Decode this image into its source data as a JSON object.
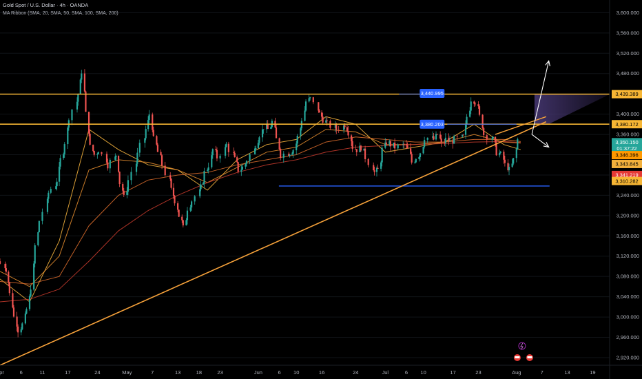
{
  "header": {
    "title": "Gold Spot / U.S. Dollar · 4h · OANDA",
    "indicator": "MA Ribbon (SMA, 20, SMA, 50, SMA, 100, SMA, 200)"
  },
  "colors": {
    "background": "#000000",
    "bull": "#26a69a",
    "bear": "#ef5350",
    "resistance": "#f7b634",
    "trendline": "#f7a23a",
    "support": "#2962ff",
    "ma20": "#f2b03c",
    "ma50": "#e08a2e",
    "ma100": "#d5692b",
    "ma200": "#c0392b",
    "arrow": "#ffffff",
    "zone": "#4a3a78"
  },
  "chart_data": {
    "type": "candlestick",
    "x_tick_labels": [
      "Apr",
      "6",
      "11",
      "17",
      "24",
      "May",
      "7",
      "13",
      "18",
      "23",
      "Jun",
      "6",
      "10",
      "16",
      "24",
      "Jul",
      "6",
      "10",
      "17",
      "23",
      "Aug",
      "7",
      "13",
      "19"
    ],
    "y_tick_labels": [
      "2,920.000",
      "2,960.000",
      "3,000.000",
      "3,040.000",
      "3,080.000",
      "3,120.000",
      "3,160.000",
      "3,200.000",
      "3,240.000",
      "3,280.000",
      "3,320.000",
      "3,360.000",
      "3,400.000",
      "3,440.000",
      "3,480.000",
      "3,520.000",
      "3,560.000",
      "3,600.000"
    ],
    "y_ticks": [
      2920,
      2960,
      3000,
      3040,
      3080,
      3120,
      3160,
      3200,
      3240,
      3280,
      3320,
      3360,
      3400,
      3440,
      3480,
      3520,
      3560,
      3600
    ],
    "ylim": [
      2905,
      3625
    ],
    "x_start": "2025-04-01",
    "x_end": "2025-08-23",
    "closes": [
      [
        "2025-04-01",
        3110
      ],
      [
        "2025-04-03",
        3095
      ],
      [
        "2025-04-04",
        3045
      ],
      [
        "2025-04-05",
        3000
      ],
      [
        "2025-04-06",
        2975
      ],
      [
        "2025-04-07",
        2985
      ],
      [
        "2025-04-08",
        3015
      ],
      [
        "2025-04-09",
        3060
      ],
      [
        "2025-04-10",
        3140
      ],
      [
        "2025-04-11",
        3190
      ],
      [
        "2025-04-13",
        3245
      ],
      [
        "2025-04-15",
        3270
      ],
      [
        "2025-04-16",
        3310
      ],
      [
        "2025-04-17",
        3345
      ],
      [
        "2025-04-18",
        3395
      ],
      [
        "2025-04-20",
        3440
      ],
      [
        "2025-04-21",
        3485
      ],
      [
        "2025-04-22",
        3400
      ],
      [
        "2025-04-23",
        3335
      ],
      [
        "2025-04-24",
        3320
      ],
      [
        "2025-04-25",
        3330
      ],
      [
        "2025-04-27",
        3300
      ],
      [
        "2025-04-29",
        3320
      ],
      [
        "2025-04-30",
        3265
      ],
      [
        "2025-05-01",
        3235
      ],
      [
        "2025-05-02",
        3270
      ],
      [
        "2025-05-04",
        3320
      ],
      [
        "2025-05-06",
        3370
      ],
      [
        "2025-05-07",
        3400
      ],
      [
        "2025-05-08",
        3350
      ],
      [
        "2025-05-09",
        3325
      ],
      [
        "2025-05-10",
        3300
      ],
      [
        "2025-05-12",
        3250
      ],
      [
        "2025-05-13",
        3230
      ],
      [
        "2025-05-14",
        3200
      ],
      [
        "2025-05-15",
        3175
      ],
      [
        "2025-05-16",
        3215
      ],
      [
        "2025-05-17",
        3230
      ],
      [
        "2025-05-19",
        3255
      ],
      [
        "2025-05-20",
        3285
      ],
      [
        "2025-05-21",
        3300
      ],
      [
        "2025-05-22",
        3330
      ],
      [
        "2025-05-23",
        3315
      ],
      [
        "2025-05-25",
        3340
      ],
      [
        "2025-05-27",
        3310
      ],
      [
        "2025-05-28",
        3290
      ],
      [
        "2025-05-29",
        3295
      ],
      [
        "2025-05-30",
        3310
      ],
      [
        "2025-06-01",
        3340
      ],
      [
        "2025-06-02",
        3360
      ],
      [
        "2025-06-03",
        3375
      ],
      [
        "2025-06-04",
        3370
      ],
      [
        "2025-06-05",
        3385
      ],
      [
        "2025-06-06",
        3350
      ],
      [
        "2025-06-07",
        3320
      ],
      [
        "2025-06-09",
        3325
      ],
      [
        "2025-06-10",
        3330
      ],
      [
        "2025-06-11",
        3355
      ],
      [
        "2025-06-12",
        3390
      ],
      [
        "2025-06-13",
        3425
      ],
      [
        "2025-06-14",
        3430
      ],
      [
        "2025-06-16",
        3400
      ],
      [
        "2025-06-17",
        3390
      ],
      [
        "2025-06-18",
        3380
      ],
      [
        "2025-06-20",
        3370
      ],
      [
        "2025-06-22",
        3380
      ],
      [
        "2025-06-23",
        3365
      ],
      [
        "2025-06-24",
        3335
      ],
      [
        "2025-06-25",
        3330
      ],
      [
        "2025-06-26",
        3335
      ],
      [
        "2025-06-27",
        3315
      ],
      [
        "2025-06-29",
        3285
      ],
      [
        "2025-06-30",
        3290
      ],
      [
        "2025-07-01",
        3330
      ],
      [
        "2025-07-02",
        3345
      ],
      [
        "2025-07-03",
        3340
      ],
      [
        "2025-07-04",
        3335
      ],
      [
        "2025-07-06",
        3340
      ],
      [
        "2025-07-07",
        3330
      ],
      [
        "2025-07-08",
        3305
      ],
      [
        "2025-07-09",
        3315
      ],
      [
        "2025-07-10",
        3325
      ],
      [
        "2025-07-11",
        3355
      ],
      [
        "2025-07-13",
        3350
      ],
      [
        "2025-07-14",
        3360
      ],
      [
        "2025-07-15",
        3340
      ],
      [
        "2025-07-16",
        3350
      ],
      [
        "2025-07-17",
        3345
      ],
      [
        "2025-07-18",
        3350
      ],
      [
        "2025-07-20",
        3355
      ],
      [
        "2025-07-21",
        3395
      ],
      [
        "2025-07-22",
        3430
      ],
      [
        "2025-07-23",
        3425
      ],
      [
        "2025-07-24",
        3395
      ],
      [
        "2025-07-25",
        3360
      ],
      [
        "2025-07-27",
        3350
      ],
      [
        "2025-07-28",
        3325
      ],
      [
        "2025-07-29",
        3320
      ],
      [
        "2025-07-30",
        3300
      ],
      [
        "2025-07-31",
        3290
      ],
      [
        "2025-08-01",
        3310
      ],
      [
        "2025-08-02",
        3350
      ]
    ],
    "moving_averages": [
      {
        "name": "SMA 20",
        "points": [
          [
            "2025-04-01",
            3075
          ],
          [
            "2025-04-08",
            3030
          ],
          [
            "2025-04-15",
            3150
          ],
          [
            "2025-04-22",
            3370
          ],
          [
            "2025-04-29",
            3330
          ],
          [
            "2025-05-06",
            3300
          ],
          [
            "2025-05-13",
            3290
          ],
          [
            "2025-05-20",
            3250
          ],
          [
            "2025-05-27",
            3310
          ],
          [
            "2025-06-03",
            3340
          ],
          [
            "2025-06-10",
            3350
          ],
          [
            "2025-06-17",
            3395
          ],
          [
            "2025-06-24",
            3380
          ],
          [
            "2025-07-01",
            3325
          ],
          [
            "2025-07-08",
            3335
          ],
          [
            "2025-07-15",
            3345
          ],
          [
            "2025-07-22",
            3380
          ],
          [
            "2025-07-29",
            3340
          ],
          [
            "2025-08-02",
            3330
          ]
        ]
      },
      {
        "name": "SMA 50",
        "points": [
          [
            "2025-04-01",
            3090
          ],
          [
            "2025-04-08",
            3060
          ],
          [
            "2025-04-15",
            3120
          ],
          [
            "2025-04-22",
            3290
          ],
          [
            "2025-04-29",
            3310
          ],
          [
            "2025-05-06",
            3305
          ],
          [
            "2025-05-13",
            3290
          ],
          [
            "2025-05-20",
            3265
          ],
          [
            "2025-05-27",
            3295
          ],
          [
            "2025-06-03",
            3325
          ],
          [
            "2025-06-10",
            3335
          ],
          [
            "2025-06-17",
            3370
          ],
          [
            "2025-06-24",
            3365
          ],
          [
            "2025-07-01",
            3340
          ],
          [
            "2025-07-08",
            3340
          ],
          [
            "2025-07-15",
            3345
          ],
          [
            "2025-07-22",
            3360
          ],
          [
            "2025-07-29",
            3345
          ],
          [
            "2025-08-02",
            3343
          ]
        ]
      },
      {
        "name": "SMA 100",
        "points": [
          [
            "2025-04-01",
            3070
          ],
          [
            "2025-04-08",
            3065
          ],
          [
            "2025-04-15",
            3080
          ],
          [
            "2025-04-22",
            3180
          ],
          [
            "2025-04-29",
            3240
          ],
          [
            "2025-05-06",
            3270
          ],
          [
            "2025-05-13",
            3280
          ],
          [
            "2025-05-20",
            3285
          ],
          [
            "2025-05-27",
            3300
          ],
          [
            "2025-06-03",
            3310
          ],
          [
            "2025-06-10",
            3320
          ],
          [
            "2025-06-17",
            3345
          ],
          [
            "2025-06-24",
            3355
          ],
          [
            "2025-07-01",
            3350
          ],
          [
            "2025-07-08",
            3345
          ],
          [
            "2025-07-15",
            3345
          ],
          [
            "2025-07-22",
            3350
          ],
          [
            "2025-07-29",
            3350
          ],
          [
            "2025-08-02",
            3346
          ]
        ]
      },
      {
        "name": "SMA 200",
        "points": [
          [
            "2025-04-01",
            3030
          ],
          [
            "2025-04-08",
            3035
          ],
          [
            "2025-04-15",
            3055
          ],
          [
            "2025-04-22",
            3110
          ],
          [
            "2025-04-29",
            3170
          ],
          [
            "2025-05-06",
            3210
          ],
          [
            "2025-05-13",
            3240
          ],
          [
            "2025-05-20",
            3265
          ],
          [
            "2025-05-27",
            3285
          ],
          [
            "2025-06-03",
            3300
          ],
          [
            "2025-06-10",
            3310
          ],
          [
            "2025-06-17",
            3325
          ],
          [
            "2025-06-24",
            3335
          ],
          [
            "2025-07-01",
            3338
          ],
          [
            "2025-07-08",
            3340
          ],
          [
            "2025-07-15",
            3342
          ],
          [
            "2025-07-22",
            3345
          ],
          [
            "2025-07-29",
            3346
          ],
          [
            "2025-08-02",
            3344
          ]
        ]
      }
    ],
    "resistance_lines": [
      {
        "value": 3439.389,
        "label": "3,439.389"
      },
      {
        "value": 3380.172,
        "label": "3,380.172"
      }
    ],
    "support_line": {
      "value": 3310.282,
      "from": "2025-06-01",
      "to": "2025-08-08"
    },
    "trendline": {
      "from": [
        "2025-04-01",
        2905
      ],
      "to": [
        "2025-08-08",
        3385
      ]
    },
    "channel_line": {
      "from": [
        "2025-07-27",
        3360
      ],
      "to": [
        "2025-08-08",
        3395
      ]
    },
    "callouts": [
      {
        "date": "2025-07-01",
        "value": 3440.995,
        "label": "3,440.995"
      },
      {
        "date": "2025-07-01",
        "value": 3380.203,
        "label": "3,380.203"
      }
    ],
    "price_tags": [
      {
        "value": 3439.389,
        "label": "3,439.389",
        "color": "#f7b634"
      },
      {
        "value": 3380.172,
        "label": "3,380.172",
        "color": "#f7b634"
      },
      {
        "value": 3350.15,
        "label": "3,350.150",
        "sub": "01:37:22",
        "color": "#26a69a"
      },
      {
        "value": 3346.396,
        "label": "3,346.396",
        "color": "#ff9800"
      },
      {
        "value": 3343.845,
        "label": "3,343.845",
        "color": "#f2b03c"
      },
      {
        "value": 3341.219,
        "label": "3,341.219",
        "color": "#e53935"
      },
      {
        "value": 3310.282,
        "label": "3,310.282",
        "color": "#f7b634"
      }
    ],
    "projection_arrows": [
      {
        "from": [
          "2025-08-03",
          3360
        ],
        "to": [
          "2025-08-07",
          3505
        ]
      },
      {
        "from": [
          "2025-08-03",
          3360
        ],
        "to": [
          "2025-08-07",
          3335
        ]
      }
    ],
    "zone": {
      "from": "2025-08-02",
      "to": "2025-08-23",
      "top": 3439,
      "bottom": 3380
    }
  }
}
